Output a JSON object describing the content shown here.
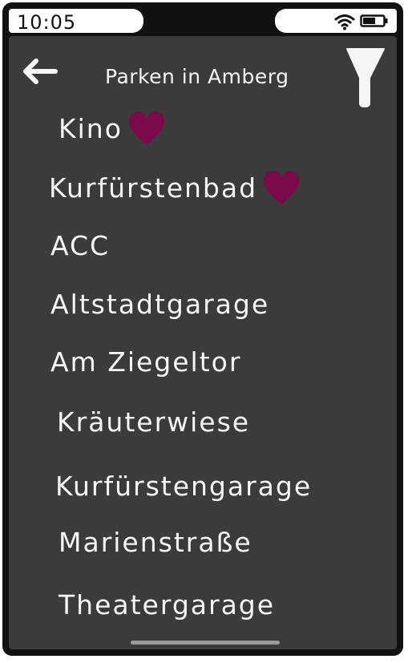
{
  "status_bar": {
    "time": "10:05"
  },
  "header": {
    "title": "Parken in Amberg"
  },
  "colors": {
    "screen_bg": "#3b3b3b",
    "text": "#f6f6f6",
    "favorite_heart": "#7a0a4a",
    "frame": "#111111"
  },
  "icons": {
    "back": "back-arrow-icon",
    "filter": "filter-funnel-icon",
    "favorite": "heart-icon",
    "wifi": "wifi-icon",
    "battery": "battery-icon"
  },
  "parking_list": [
    {
      "name": "Kino",
      "favorite": true
    },
    {
      "name": "Kurfürstenbad",
      "favorite": true
    },
    {
      "name": "ACC",
      "favorite": false
    },
    {
      "name": "Altstadtgarage",
      "favorite": false
    },
    {
      "name": "Am Ziegeltor",
      "favorite": false
    },
    {
      "name": "Kräuterwiese",
      "favorite": false
    },
    {
      "name": "Kurfürstengarage",
      "favorite": false
    },
    {
      "name": "Marienstraße",
      "favorite": false
    },
    {
      "name": "Theatergarage",
      "favorite": false
    }
  ]
}
